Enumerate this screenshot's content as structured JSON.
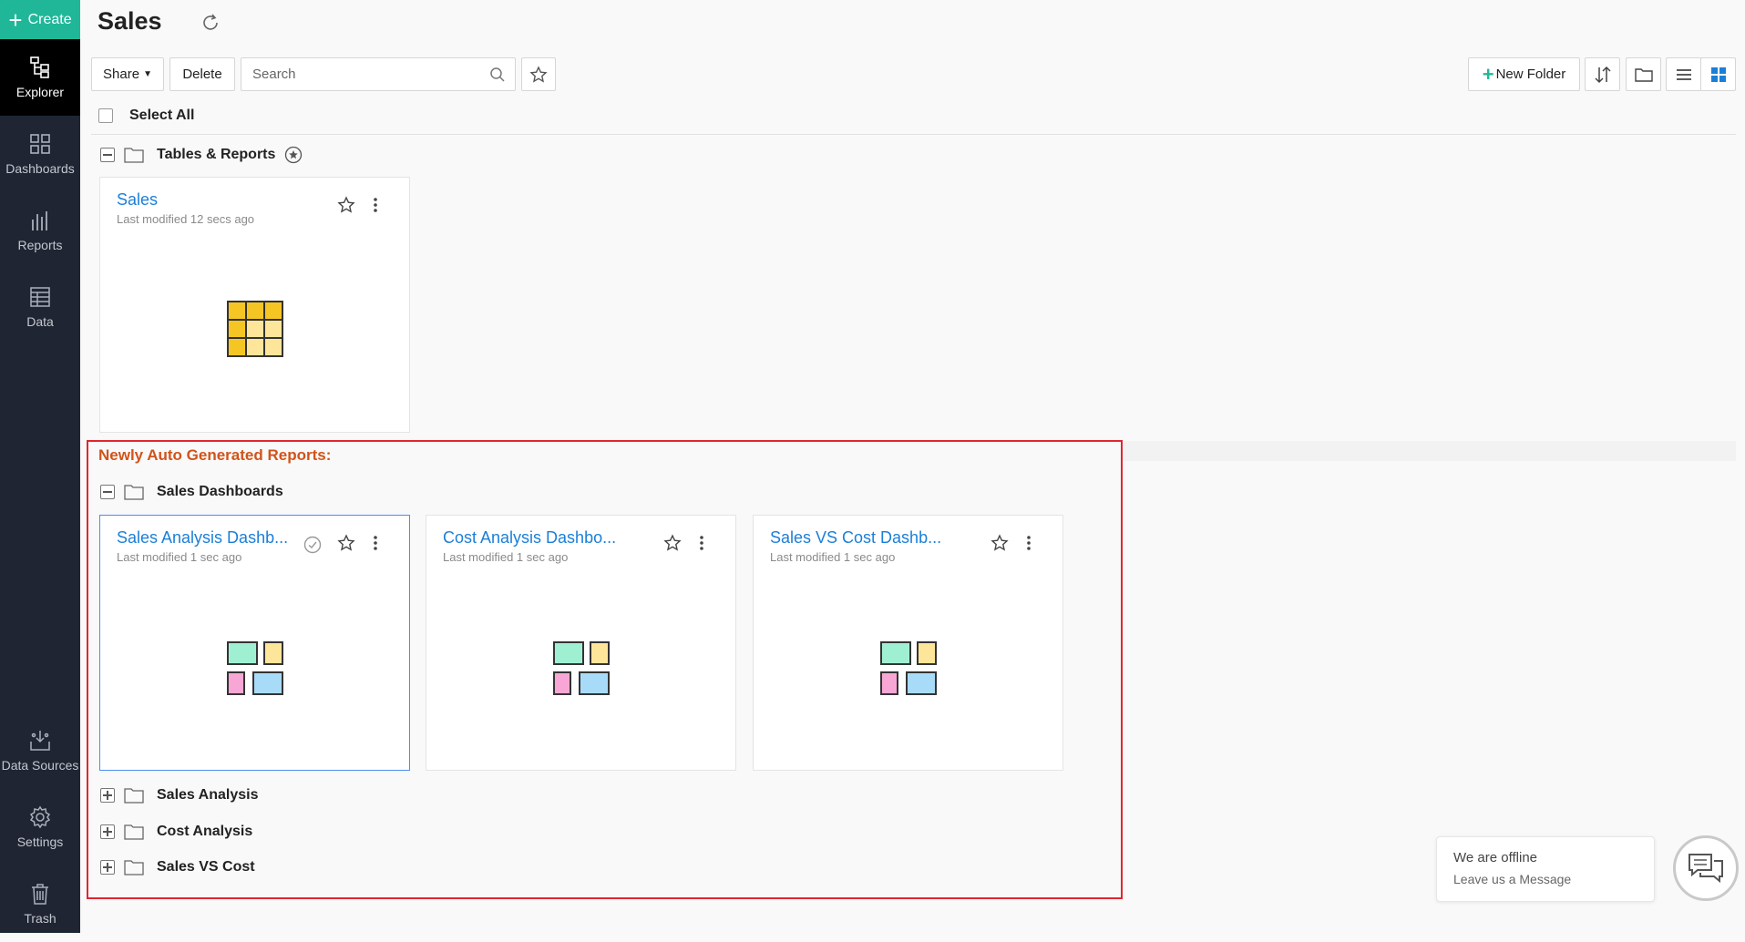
{
  "sidebar": {
    "create_label": "Create",
    "items": [
      {
        "label": "Explorer",
        "icon": "explorer-icon"
      },
      {
        "label": "Dashboards",
        "icon": "dashboards-icon"
      },
      {
        "label": "Reports",
        "icon": "reports-icon"
      },
      {
        "label": "Data",
        "icon": "data-icon"
      },
      {
        "label": "Data Sources",
        "icon": "data-sources-icon"
      },
      {
        "label": "Settings",
        "icon": "gear-icon"
      },
      {
        "label": "Trash",
        "icon": "trash-icon"
      }
    ]
  },
  "header": {
    "title": "Sales"
  },
  "toolbar": {
    "share_label": "Share",
    "delete_label": "Delete",
    "search_placeholder": "Search",
    "new_folder_label": "New Folder"
  },
  "select_all_label": "Select All",
  "sections": {
    "tables_reports": {
      "folder_label": "Tables & Reports",
      "cards": [
        {
          "title": "Sales",
          "modified": "Last modified 12 secs ago",
          "type": "table"
        }
      ]
    },
    "newly_generated_label": "Newly Auto Generated Reports:",
    "sales_dashboards": {
      "folder_label": "Sales Dashboards",
      "cards": [
        {
          "title": "Sales Analysis Dashb...",
          "modified": "Last modified 1 sec ago",
          "type": "dashboard"
        },
        {
          "title": "Cost Analysis Dashbo...",
          "modified": "Last modified 1 sec ago",
          "type": "dashboard"
        },
        {
          "title": "Sales VS Cost Dashb...",
          "modified": "Last modified 1 sec ago",
          "type": "dashboard"
        }
      ]
    },
    "collapsed_folders": [
      "Sales Analysis",
      "Cost Analysis",
      "Sales VS Cost"
    ]
  },
  "chat": {
    "status": "We are offline",
    "cta": "Leave us a Message"
  },
  "colors": {
    "sidebar_bg": "#1f2532",
    "create_green": "#20b799",
    "link_blue": "#1b7fd8",
    "highlight_red": "#e0262f",
    "newly_orange": "#d1531a",
    "grid_active_blue": "#1b7fd8"
  }
}
